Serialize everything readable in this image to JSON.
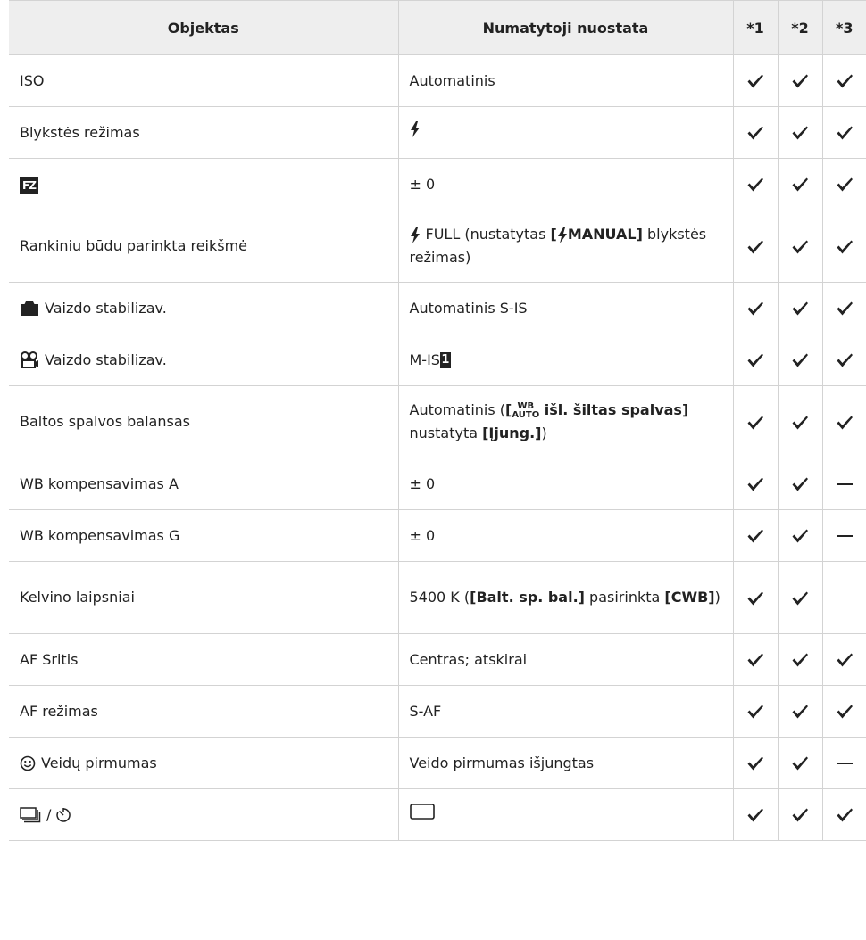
{
  "table": {
    "headers": {
      "item": "Objektas",
      "default": "Numatytoji nuostata",
      "col1": "*1",
      "col2": "*2",
      "col3": "*3"
    },
    "rows": [
      {
        "item": "ISO",
        "default": "Automatinis",
        "marks": [
          "check",
          "check",
          "check"
        ]
      },
      {
        "item": "Blykstės režimas",
        "default_icon": "flash-icon",
        "marks": [
          "check",
          "check",
          "check"
        ]
      },
      {
        "item_icon_text": "FZ",
        "item_icon": "flash-compensation-icon",
        "default": "± 0",
        "marks": [
          "check",
          "check",
          "check"
        ]
      },
      {
        "item": "Rankiniu būdu parinkta reikšmė",
        "default_prefix": "FULL (nustatytas ",
        "default_bold_open": "[",
        "default_bold_text": "MANUAL]",
        "default_suffix": " blykstės režimas)",
        "marks": [
          "check",
          "check",
          "check"
        ]
      },
      {
        "item": "Vaizdo stabilizav.",
        "item_icon": "camera-icon",
        "default": "Automatinis S-IS",
        "marks": [
          "check",
          "check",
          "check"
        ]
      },
      {
        "item": "Vaizdo stabilizav.",
        "item_icon": "movie-icon",
        "default": "M-IS",
        "default_badge": "1",
        "marks": [
          "check",
          "check",
          "check"
        ]
      },
      {
        "item": "Baltos spalvos balansas",
        "default_prefix": "Automatinis (",
        "default_wb_top": "WB",
        "default_wb_bottom": "AUTO",
        "default_bold_a": " išl. šiltas spalvas]",
        "default_mid": " nustatyta ",
        "default_bold_b": "[Įjung.]",
        "default_suffix": ")",
        "marks": [
          "check",
          "check",
          "check"
        ]
      },
      {
        "item": "WB kompensavimas A",
        "default": "± 0",
        "marks": [
          "check",
          "check",
          "dash"
        ]
      },
      {
        "item": "WB kompensavimas G",
        "default": "± 0",
        "marks": [
          "check",
          "check",
          "dash"
        ]
      },
      {
        "item": "Kelvino laipsniai",
        "default_prefix": "5400 K (",
        "default_bold_a": "[Balt. sp. bal.]",
        "default_mid": " pasirinkta ",
        "default_bold_b": "[CWB]",
        "default_suffix": ")",
        "marks": [
          "check",
          "check",
          "dash"
        ]
      },
      {
        "item": "AF Sritis",
        "default": "Centras; atskirai",
        "marks": [
          "check",
          "check",
          "check"
        ]
      },
      {
        "item": "AF režimas",
        "default": "S-AF",
        "marks": [
          "check",
          "check",
          "check"
        ]
      },
      {
        "item": "Veidų pirmumas",
        "item_icon": "face-icon",
        "default": "Veido pirmumas išjungtas",
        "marks": [
          "check",
          "check",
          "dash"
        ]
      },
      {
        "item": "/",
        "item_icon": "sequential-shooting-icon",
        "item_icon2": "self-timer-icon",
        "default_icon": "single-frame-icon",
        "marks": [
          "check",
          "check",
          "check"
        ]
      }
    ]
  }
}
